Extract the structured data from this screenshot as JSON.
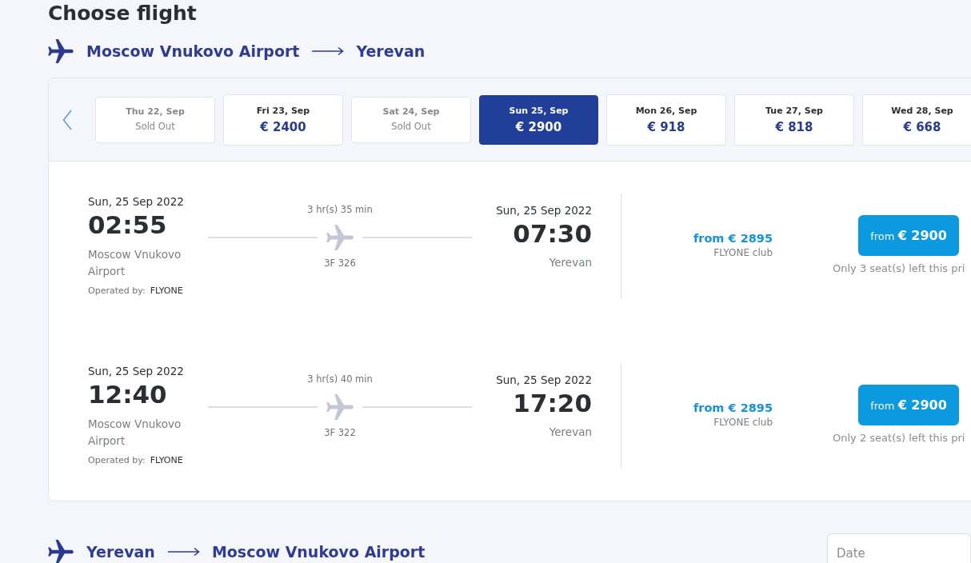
{
  "title": "Choose flight",
  "outbound": {
    "route": {
      "from": "Moscow Vnukovo Airport",
      "to": "Yerevan"
    },
    "dates": [
      {
        "label": "Thu 22, Sep",
        "price": "Sold Out",
        "sold_out": true,
        "selected": false
      },
      {
        "label": "Fri 23, Sep",
        "price": "€ 2400",
        "sold_out": false,
        "selected": false
      },
      {
        "label": "Sat 24, Sep",
        "price": "Sold Out",
        "sold_out": true,
        "selected": false
      },
      {
        "label": "Sun 25, Sep",
        "price": "€ 2900",
        "sold_out": false,
        "selected": true
      },
      {
        "label": "Mon 26, Sep",
        "price": "€ 918",
        "sold_out": false,
        "selected": false
      },
      {
        "label": "Tue 27, Sep",
        "price": "€ 818",
        "sold_out": false,
        "selected": false
      },
      {
        "label": "Wed 28, Sep",
        "price": "€ 668",
        "sold_out": false,
        "selected": false
      }
    ],
    "flights": [
      {
        "departure": {
          "date": "Sun, 25 Sep 2022",
          "time": "02:55",
          "airport": "Moscow Vnukovo Airport"
        },
        "operator_label": "Operated by:",
        "operator": "FLYONE",
        "duration": "3 hr(s) 35 min",
        "flight_number": "3F 326",
        "arrival": {
          "date": "Sun, 25 Sep 2022",
          "time": "07:30",
          "city": "Yerevan"
        },
        "club_price": "from € 2895",
        "club_label": "FLYONE club",
        "button": {
          "prefix": "from",
          "price": "€ 2900"
        },
        "seats_note": "Only 3 seat(s) left this pri"
      },
      {
        "departure": {
          "date": "Sun, 25 Sep 2022",
          "time": "12:40",
          "airport": "Moscow Vnukovo Airport"
        },
        "operator_label": "Operated by:",
        "operator": "FLYONE",
        "duration": "3 hr(s) 40 min",
        "flight_number": "3F 322",
        "arrival": {
          "date": "Sun, 25 Sep 2022",
          "time": "17:20",
          "city": "Yerevan"
        },
        "club_price": "from € 2895",
        "club_label": "FLYONE club",
        "button": {
          "prefix": "from",
          "price": "€ 2900"
        },
        "seats_note": "Only 2 seat(s) left this pri"
      }
    ]
  },
  "return": {
    "route": {
      "from": "Yerevan",
      "to": "Moscow Vnukovo Airport"
    },
    "date_field": {
      "placeholder": "Date"
    }
  }
}
